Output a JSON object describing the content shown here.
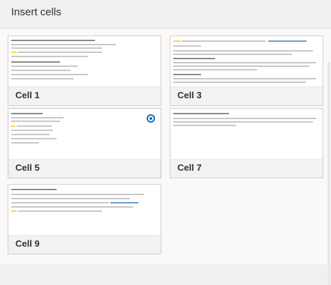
{
  "dialog": {
    "title": "Insert cells"
  },
  "cells": [
    {
      "label": "Cell 1"
    },
    {
      "label": "Cell 3"
    },
    {
      "label": "Cell 5",
      "selected": true
    },
    {
      "label": "Cell 7"
    },
    {
      "label": "Cell 9"
    }
  ],
  "colors": {
    "accent": "#0f6cbd",
    "highlight": "#ffd335"
  }
}
